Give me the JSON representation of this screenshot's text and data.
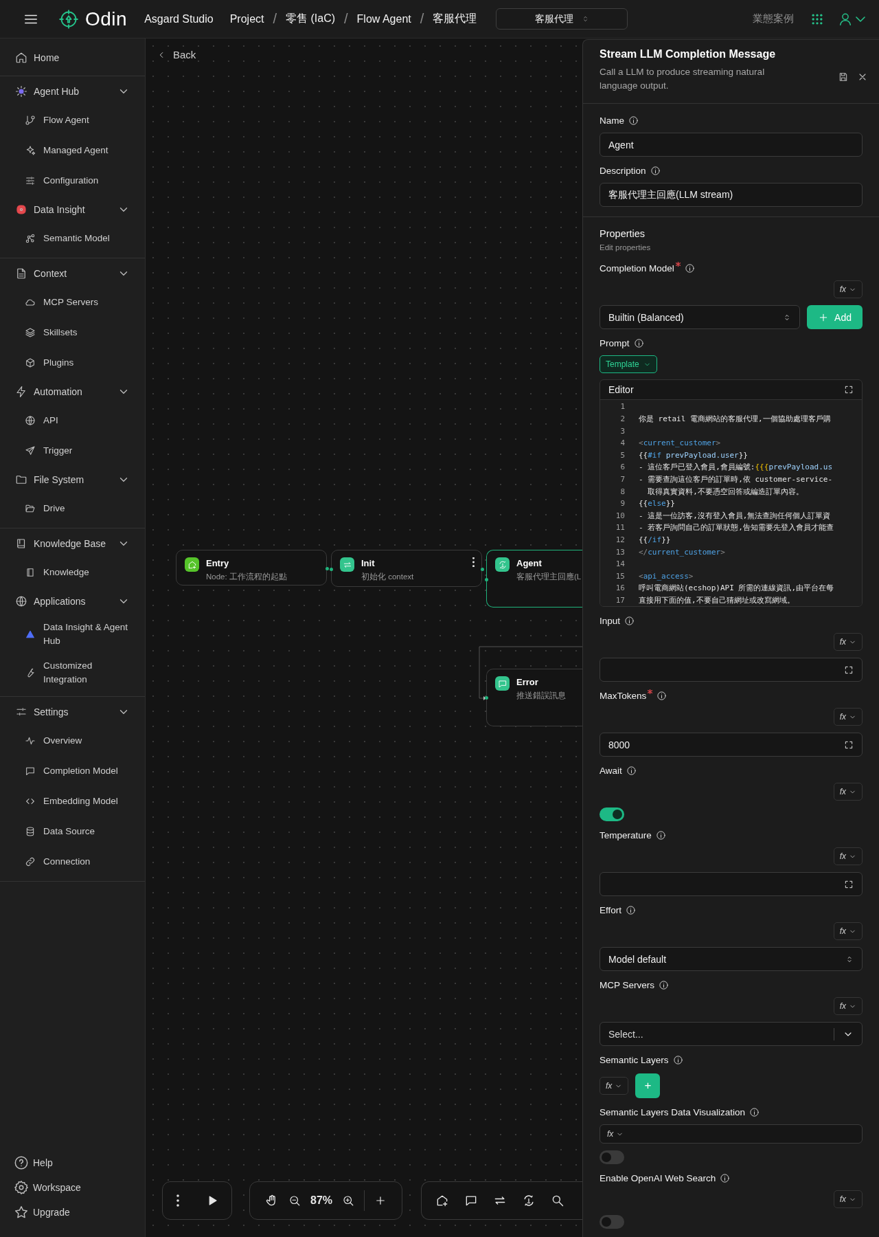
{
  "topbar": {
    "brand": "Odin",
    "workspace": "Asgard Studio",
    "separator": "/",
    "breadcrumbs": [
      "Project",
      "零售 (IaC)",
      "Flow Agent",
      "客服代理"
    ],
    "selector": "客服代理",
    "link": "業態案例"
  },
  "sidebar": {
    "sections": [
      {
        "items": [
          {
            "label": "Home"
          }
        ]
      },
      {
        "items": [
          {
            "label": "Agent Hub",
            "expanded": true,
            "children": [
              {
                "label": "Flow Agent"
              },
              {
                "label": "Managed Agent"
              },
              {
                "label": "Configuration"
              }
            ]
          },
          {
            "label": "Data Insight",
            "expanded": true,
            "children": [
              {
                "label": "Semantic Model"
              }
            ]
          }
        ]
      },
      {
        "items": [
          {
            "label": "Context",
            "expanded": true,
            "children": [
              {
                "label": "MCP Servers"
              },
              {
                "label": "Skillsets"
              },
              {
                "label": "Plugins"
              }
            ]
          },
          {
            "label": "Automation",
            "expanded": true,
            "children": [
              {
                "label": "API"
              },
              {
                "label": "Trigger"
              }
            ]
          },
          {
            "label": "File System",
            "expanded": true,
            "children": [
              {
                "label": "Drive"
              }
            ]
          }
        ]
      },
      {
        "items": [
          {
            "label": "Knowledge Base",
            "expanded": true,
            "children": [
              {
                "label": "Knowledge"
              }
            ]
          },
          {
            "label": "Applications",
            "expanded": true,
            "children": [
              {
                "label": "Data Insight & Agent Hub"
              },
              {
                "label": "Customized Integration"
              }
            ]
          }
        ]
      },
      {
        "items": [
          {
            "label": "Settings",
            "expanded": true,
            "children": [
              {
                "label": "Overview"
              },
              {
                "label": "Completion Model"
              },
              {
                "label": "Embedding Model"
              },
              {
                "label": "Data Source"
              },
              {
                "label": "Connection"
              }
            ]
          }
        ]
      }
    ],
    "footer": [
      {
        "label": "Help"
      },
      {
        "label": "Workspace"
      },
      {
        "label": "Upgrade"
      }
    ]
  },
  "canvas": {
    "back": "Back",
    "nodes": [
      {
        "kind": "entry",
        "title": "Entry",
        "subtitle": "Node: 工作流程的起點",
        "selected": false
      },
      {
        "kind": "transform",
        "title": "Init",
        "subtitle": "初始化 context",
        "selected": false
      },
      {
        "kind": "agent",
        "title": "Agent",
        "subtitle": "客服代理主回應(L",
        "selected": true
      },
      {
        "kind": "message",
        "title": "Error",
        "subtitle": "推送錯誤訊息",
        "selected": false
      }
    ]
  },
  "toolbar": {
    "zoom": "87%"
  },
  "panel": {
    "title": "Stream LLM Completion Message",
    "description": "Call a LLM to produce streaming natural language output.",
    "basic_fields": [
      {
        "label": "Name",
        "value": "Agent"
      },
      {
        "label": "Description",
        "value": "客服代理主回應(LLM stream)"
      }
    ],
    "properties": {
      "title": "Properties",
      "subtitle": "Edit properties",
      "fields": [
        {
          "kind": "select-add",
          "label": "Completion Model",
          "required": true,
          "fx": "fx",
          "value": "Builtin (Balanced)",
          "button": "Add"
        },
        {
          "kind": "editor",
          "label": "Prompt",
          "required": false,
          "template": "Template",
          "editor_title": "Editor",
          "lines": [
            {
              "number": "1"
            },
            {
              "number": "2",
              "segments": [
                {
                  "kind": "plain",
                  "text": "你是 retail 電商網站的客服代理,一個協助處理客戶購"
                }
              ]
            },
            {
              "number": "3"
            },
            {
              "number": "4",
              "segments": [
                {
                  "kind": "punct",
                  "text": "<"
                },
                {
                  "kind": "tag",
                  "text": "current_customer"
                },
                {
                  "kind": "punct",
                  "text": ">"
                }
              ]
            },
            {
              "number": "5",
              "segments": [
                {
                  "kind": "plain",
                  "text": "{{"
                },
                {
                  "kind": "keyword",
                  "text": "#if"
                },
                {
                  "kind": "var",
                  "text": " prevPayload.user"
                },
                {
                  "kind": "plain",
                  "text": "}}"
                }
              ]
            },
            {
              "number": "6",
              "segments": [
                {
                  "kind": "plain",
                  "text": "- 這位客戶已登入會員,會員編號:"
                },
                {
                  "kind": "brace",
                  "text": "{{{"
                },
                {
                  "kind": "var",
                  "text": "prevPayload.us"
                }
              ]
            },
            {
              "number": "7",
              "segments": [
                {
                  "kind": "plain",
                  "text": "- 需要查詢這位客戶的訂單時,依 customer-service-"
                }
              ]
            },
            {
              "number": "8",
              "segments": [
                {
                  "kind": "plain",
                  "text": "  取得真實資料,不要憑空回答或編造訂單內容。"
                }
              ]
            },
            {
              "number": "9",
              "segments": [
                {
                  "kind": "plain",
                  "text": "{{"
                },
                {
                  "kind": "keyword",
                  "text": "else"
                },
                {
                  "kind": "plain",
                  "text": "}}"
                }
              ]
            },
            {
              "number": "10",
              "segments": [
                {
                  "kind": "plain",
                  "text": "- 這是一位訪客,沒有登入會員,無法查詢任何個人訂單資"
                }
              ]
            },
            {
              "number": "11",
              "segments": [
                {
                  "kind": "plain",
                  "text": "- 若客戶詢問自己的訂單狀態,告知需要先登入會員才能查"
                }
              ]
            },
            {
              "number": "12",
              "segments": [
                {
                  "kind": "plain",
                  "text": "{{"
                },
                {
                  "kind": "keyword",
                  "text": "/if"
                },
                {
                  "kind": "plain",
                  "text": "}}"
                }
              ]
            },
            {
              "number": "13",
              "segments": [
                {
                  "kind": "punct",
                  "text": "</"
                },
                {
                  "kind": "tag",
                  "text": "current_customer"
                },
                {
                  "kind": "punct",
                  "text": ">"
                }
              ]
            },
            {
              "number": "14"
            },
            {
              "number": "15",
              "segments": [
                {
                  "kind": "punct",
                  "text": "<"
                },
                {
                  "kind": "tag",
                  "text": "api_access"
                },
                {
                  "kind": "punct",
                  "text": ">"
                }
              ]
            },
            {
              "number": "16",
              "segments": [
                {
                  "kind": "plain",
                  "text": "呼叫電商網站(ecshop)API 所需的連線資訊,由平台在每"
                }
              ]
            },
            {
              "number": "17",
              "segments": [
                {
                  "kind": "plain",
                  "text": "直接用下面的值,不要自己猜網址或改寫網域。"
                }
              ]
            }
          ]
        },
        {
          "kind": "expand-input",
          "label": "Input",
          "required": false,
          "fx": "fx"
        },
        {
          "kind": "expand-input",
          "label": "MaxTokens",
          "required": true,
          "fx": "fx",
          "value": "8000"
        },
        {
          "kind": "toggle",
          "label": "Await",
          "required": false,
          "fx": "fx",
          "on": true
        },
        {
          "kind": "expand-input",
          "label": "Temperature",
          "required": false,
          "fx": "fx"
        },
        {
          "kind": "select",
          "label": "Effort",
          "required": false,
          "fx": "fx",
          "value": "Model default"
        },
        {
          "kind": "multi-select",
          "label": "MCP Servers",
          "required": false,
          "fx": "fx",
          "placeholder": "Select..."
        },
        {
          "kind": "fx-add",
          "label": "Semantic Layers",
          "required": false,
          "fx": "fx",
          "button": "+"
        },
        {
          "kind": "fx-field-toggle",
          "label": "Semantic Layers Data Visualization",
          "required": false,
          "fx": "fx",
          "on": false
        },
        {
          "kind": "toggle",
          "label": "Enable OpenAI Web Search",
          "required": false,
          "fx": "fx",
          "on": false
        }
      ]
    }
  }
}
